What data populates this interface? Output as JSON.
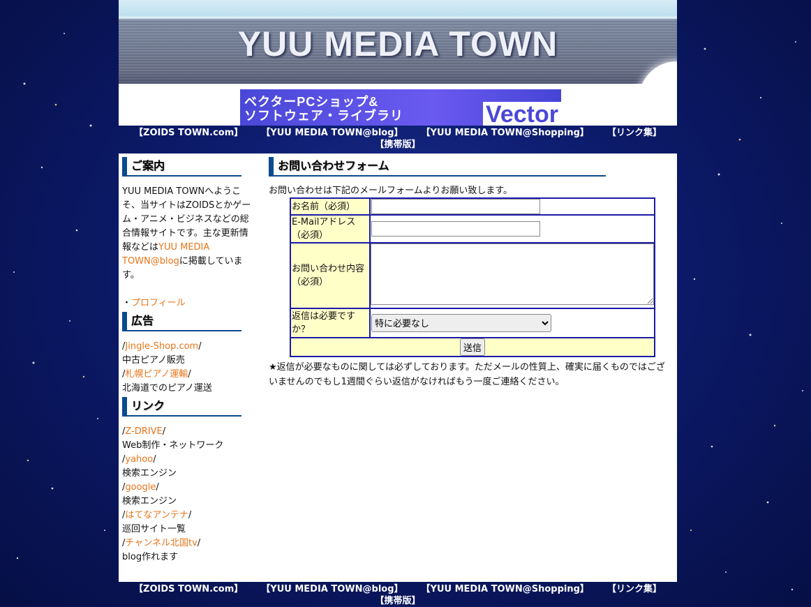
{
  "header": {
    "site_title": "YUU MEDIA TOWN"
  },
  "banner": {
    "line1": "ベクターPCショップ&",
    "line2": "ソフトウェア・ライブラリ",
    "brand": "Vector"
  },
  "nav": {
    "items": [
      "【ZOIDS TOWN.com】",
      "【YUU MEDIA TOWN@blog】",
      "【YUU MEDIA TOWN@Shopping】",
      "【リンク集】",
      "【携帯版】"
    ]
  },
  "sidebar": {
    "guide": {
      "heading": "ご案内",
      "text": "YUU MEDIA TOWNへようこそ、当サイトはZOIDSとかゲーム・アニメ・ビジネスなどの総合情報サイトです。主な更新情報などは",
      "blog_link": "YUU MEDIA TOWN@blog",
      "text_after": "に掲載しています。",
      "profile_prefix": "・",
      "profile_link": "プロフィール"
    },
    "ads": {
      "heading": "広告",
      "items": [
        {
          "link": "Jingle-Shop.com",
          "desc": "中古ピアノ販売"
        },
        {
          "link": "札幌ピアノ運輸",
          "desc": "北海道でのピアノ運送"
        }
      ]
    },
    "links": {
      "heading": "リンク",
      "items": [
        {
          "link": "Z-DRIVE",
          "desc": "Web制作・ネットワーク"
        },
        {
          "link": "yahoo",
          "desc": "検索エンジン"
        },
        {
          "link": "google",
          "desc": "検索エンジン"
        },
        {
          "link": "はてなアンテナ",
          "desc": "巡回サイト一覧"
        },
        {
          "link": "チャンネル北国tv",
          "desc": "blog作れます"
        }
      ]
    }
  },
  "main": {
    "heading": "お問い合わせフォーム",
    "intro": "お問い合わせは下記のメールフォームよりお願い致します。",
    "form": {
      "name_label": "お名前（必須）",
      "email_label": "E-Mailアドレス（必須）",
      "message_label": "お問い合わせ内容（必須）",
      "reply_label": "返信は必要ですか？",
      "reply_selected": "特に必要なし",
      "submit_label": "送信"
    },
    "note": "★返信が必要なものに関しては必ずしております。ただメールの性質上、確実に届くものではございませんのでもし1週間ぐらい返信がなければもう一度ご連絡ください。"
  },
  "colors": {
    "link": "#e8751a",
    "heading_accent": "#0a4a8e",
    "form_border": "#1a1aa8",
    "label_bg": "#ffffc8",
    "background": "#0c1a6a"
  }
}
